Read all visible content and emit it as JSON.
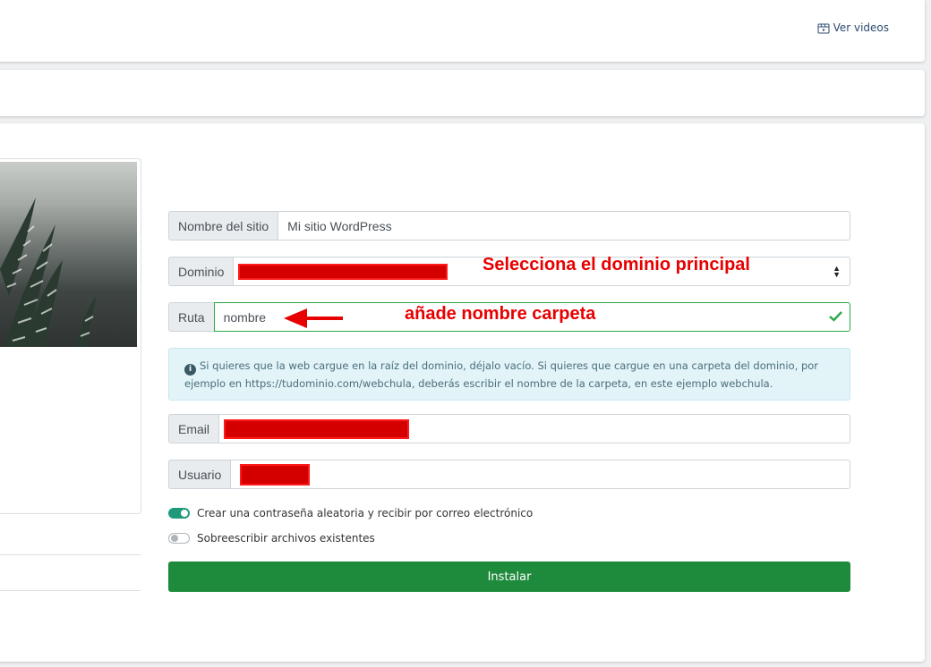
{
  "header": {
    "ver_videos_label": "Ver videos"
  },
  "form": {
    "site_name": {
      "label": "Nombre del sitio",
      "value": "Mi sitio WordPress"
    },
    "domain": {
      "label": "Dominio"
    },
    "path": {
      "label": "Ruta",
      "value": "nombre"
    },
    "info_text": "Si quieres que la web cargue en la raíz del dominio, déjalo vacío. Si quieres que cargue en una carpeta del dominio, por ejemplo en https://tudominio.com/webchula, deberás escribir el nombre de la carpeta, en este ejemplo webchula.",
    "email": {
      "label": "Email"
    },
    "user": {
      "label": "Usuario"
    },
    "toggle_password": {
      "label": "Crear una contraseña aleatoria y recibir por correo electrónico",
      "on": true
    },
    "toggle_overwrite": {
      "label": "Sobreescribir archivos existentes",
      "on": false
    },
    "install_label": "Instalar"
  },
  "annotations": {
    "domain_note": "Selecciona el dominio principal",
    "path_note": "añade nombre carpeta"
  },
  "colors": {
    "accent_green": "#1e8a3c",
    "toggle_on": "#1e9a7a",
    "annotation_red": "#e80000"
  }
}
